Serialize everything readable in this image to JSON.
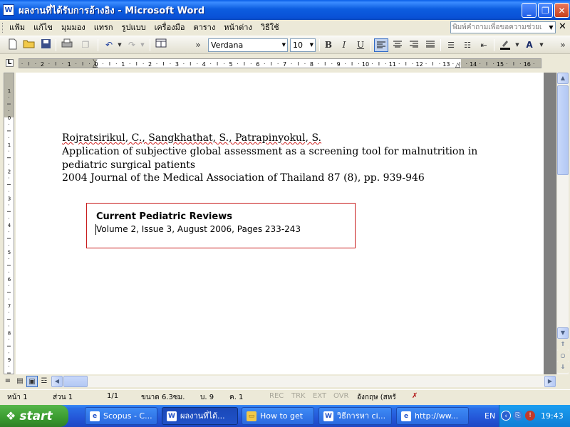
{
  "window": {
    "app_icon": "W",
    "title": "ผลงานที่ได้รับการอ้างอิง - Microsoft Word",
    "minimize_glyph": "_",
    "maximize_glyph": "❐",
    "close_glyph": "✕"
  },
  "menu": {
    "items": [
      "แฟ้ม",
      "แก้ไข",
      "มุมมอง",
      "แทรก",
      "รูปแบบ",
      "เครื่องมือ",
      "ตาราง",
      "หน้าต่าง",
      "วิธีใช้"
    ],
    "help_placeholder": "พิมพ์คำถามเพื่อขอความช่วยเ",
    "close_doc_glyph": "✕"
  },
  "toolbar": {
    "font_name": "Verdana",
    "font_size": "10",
    "bold": "B",
    "italic": "I",
    "underline": "U",
    "overflow_glyph": "»",
    "icons": [
      "new-document-icon",
      "open-folder-icon",
      "save-icon",
      "print-icon",
      "copy-icon",
      "undo-icon",
      "redo-icon",
      "table-icon",
      "align-left-icon",
      "align-center-icon",
      "align-right-icon",
      "justify-icon",
      "numbered-list-icon",
      "bulleted-list-icon",
      "decrease-indent-icon",
      "highlight-icon",
      "font-color-icon"
    ]
  },
  "ruler": {
    "corner_glyph": "L"
  },
  "document": {
    "authors": "Rojratsirikul, C., Sangkhathat, S., Patrapinyokul, S.",
    "title_line1": "Application of subjective global assessment as a screening tool for malnutrition in",
    "title_line2": "pediatric surgical patients",
    "citation": "2004 Journal of the Medical Association of Thailand 87 (8), pp. 939-946",
    "box_title": "Current Pediatric Reviews",
    "box_detail": "Volume 2, Issue 3, August 2006, Pages 233-243"
  },
  "statusbar": {
    "page": "หน้า 1",
    "section": "ส่วน 1",
    "page_of": "1/1",
    "position": "ขนาด 6.3ซม.",
    "line": "บ. 9",
    "column": "ค. 1",
    "rec": "REC",
    "trk": "TRK",
    "ext": "EXT",
    "ovr": "OVR",
    "language": "อังกฤษ (สหรั"
  },
  "taskbar": {
    "start_label": "start",
    "tasks": [
      {
        "label": "Scopus - C...",
        "icon": "browser-icon"
      },
      {
        "label": "ผลงานที่ได้...",
        "icon": "word-doc-icon",
        "active": true
      },
      {
        "label": "How to get",
        "icon": "folder-icon"
      },
      {
        "label": "วิธีการหา ci...",
        "icon": "word-doc-icon"
      },
      {
        "label": "http://ww...",
        "icon": "browser-icon"
      }
    ],
    "language": "EN",
    "clock": "19:43"
  },
  "colors": {
    "titlebar": "#0c5de0",
    "taskbar": "#2456d8",
    "start_button": "#3a9b2f",
    "box_border": "#c81c1c",
    "spell_underline": "#d02020"
  }
}
